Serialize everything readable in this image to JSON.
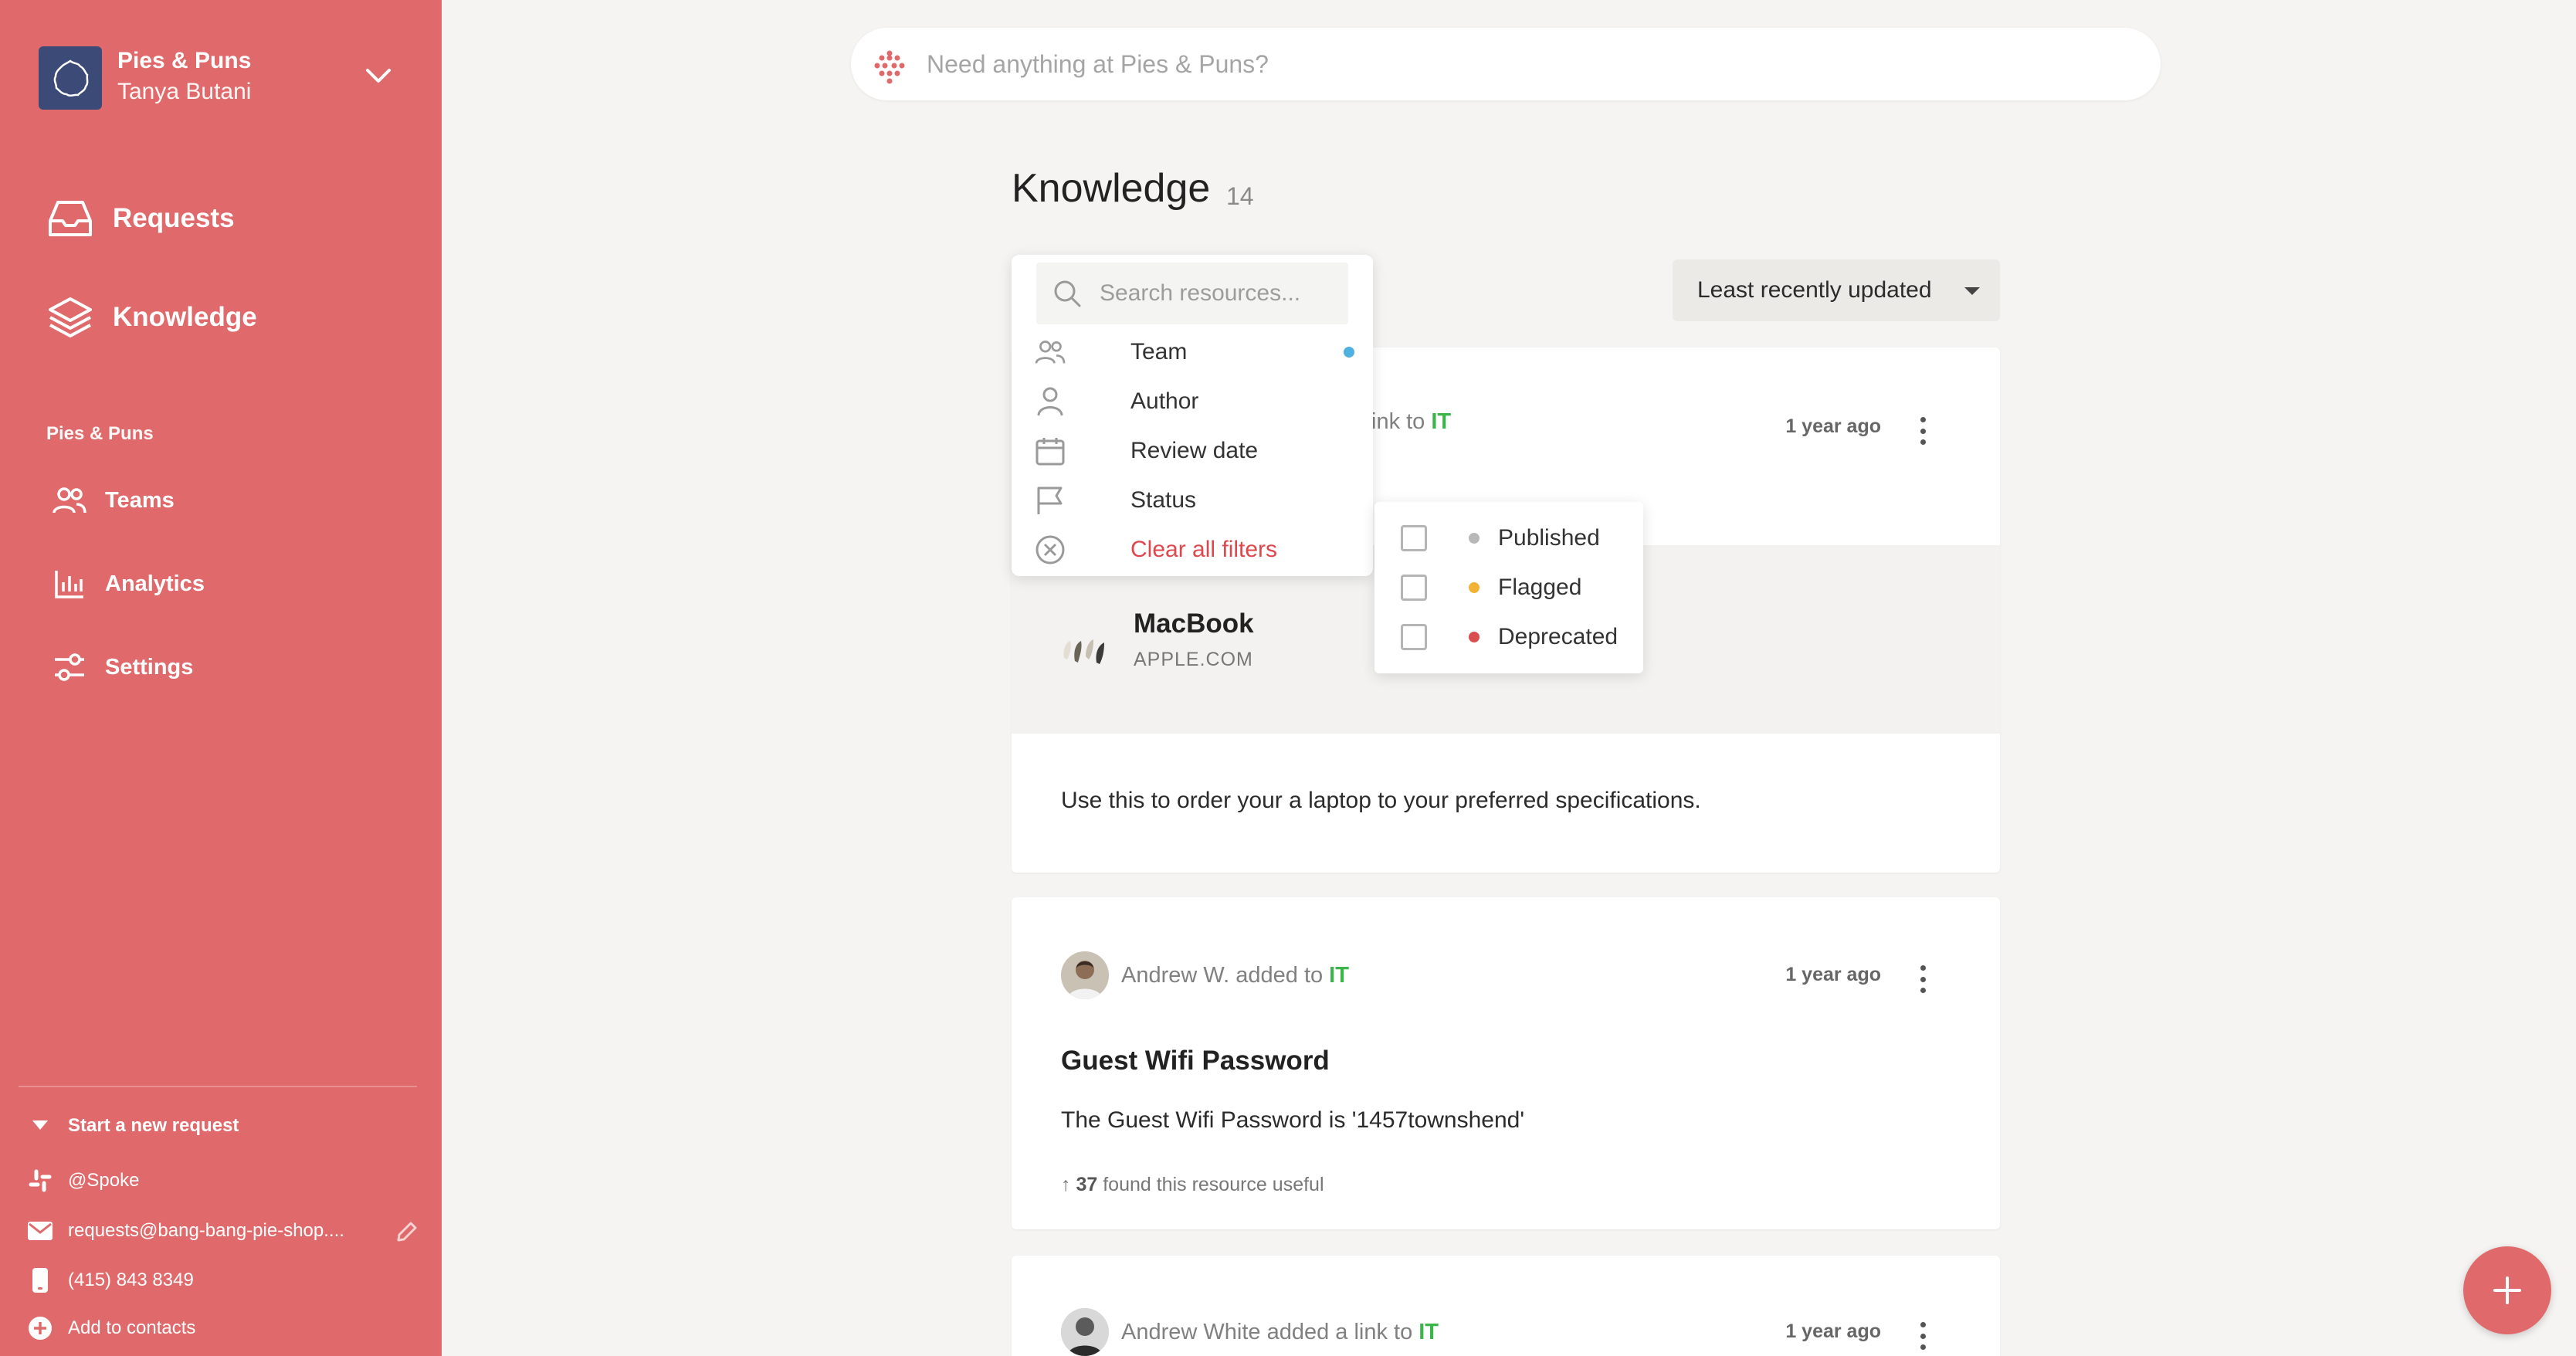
{
  "workspace": {
    "name": "Pies & Puns",
    "user": "Tanya Butani"
  },
  "nav": [
    {
      "label": "Requests",
      "icon": "inbox-icon"
    },
    {
      "label": "Knowledge",
      "icon": "layers-icon"
    }
  ],
  "section": {
    "label": "Pies & Puns",
    "items": [
      {
        "label": "Teams",
        "icon": "people-icon"
      },
      {
        "label": "Analytics",
        "icon": "bar-chart-icon"
      },
      {
        "label": "Settings",
        "icon": "sliders-icon"
      }
    ]
  },
  "footer": {
    "start_request": "Start a new request",
    "slack": "@Spoke",
    "email": "requests@bang-bang-pie-shop....",
    "phone": "(415) 843 8349",
    "add_contacts": "Add to contacts"
  },
  "topsearch": {
    "placeholder": "Need anything at Pies & Puns?"
  },
  "page": {
    "title": "Knowledge",
    "count": "14"
  },
  "sort": {
    "selected": "Least recently updated"
  },
  "filter": {
    "search_placeholder": "Search resources...",
    "items": [
      {
        "label": "Team",
        "icon": "people-icon",
        "active": true
      },
      {
        "label": "Author",
        "icon": "person-icon"
      },
      {
        "label": "Review date",
        "icon": "calendar-icon"
      },
      {
        "label": "Status",
        "icon": "flag-icon"
      }
    ],
    "clear": "Clear all filters"
  },
  "status_options": [
    {
      "label": "Published",
      "color": "#b8b8b8"
    },
    {
      "label": "Flagged",
      "color": "#f2b233"
    },
    {
      "label": "Deprecated",
      "color": "#d94f4f"
    }
  ],
  "cards": [
    {
      "meta_suffix": "ink to",
      "team": "IT",
      "time": "1 year ago",
      "link": {
        "title": "MacBook",
        "domain": "APPLE.COM"
      },
      "description": "Use this to order your a laptop to your preferred specifications."
    },
    {
      "author": "Andrew W. added to",
      "team": "IT",
      "time": "1 year ago",
      "title": "Guest Wifi Password",
      "description": "The Guest Wifi Password is '1457townshend'",
      "useful_count": "37",
      "useful_text": "found this resource useful"
    },
    {
      "author": "Andrew White added a link to",
      "team": "IT",
      "time": "1 year ago"
    }
  ],
  "colors": {
    "sidebar": "#e06a6b",
    "team_green": "#3bb54a",
    "accent_red": "#e0474c",
    "active_dot": "#4fb1e0"
  }
}
